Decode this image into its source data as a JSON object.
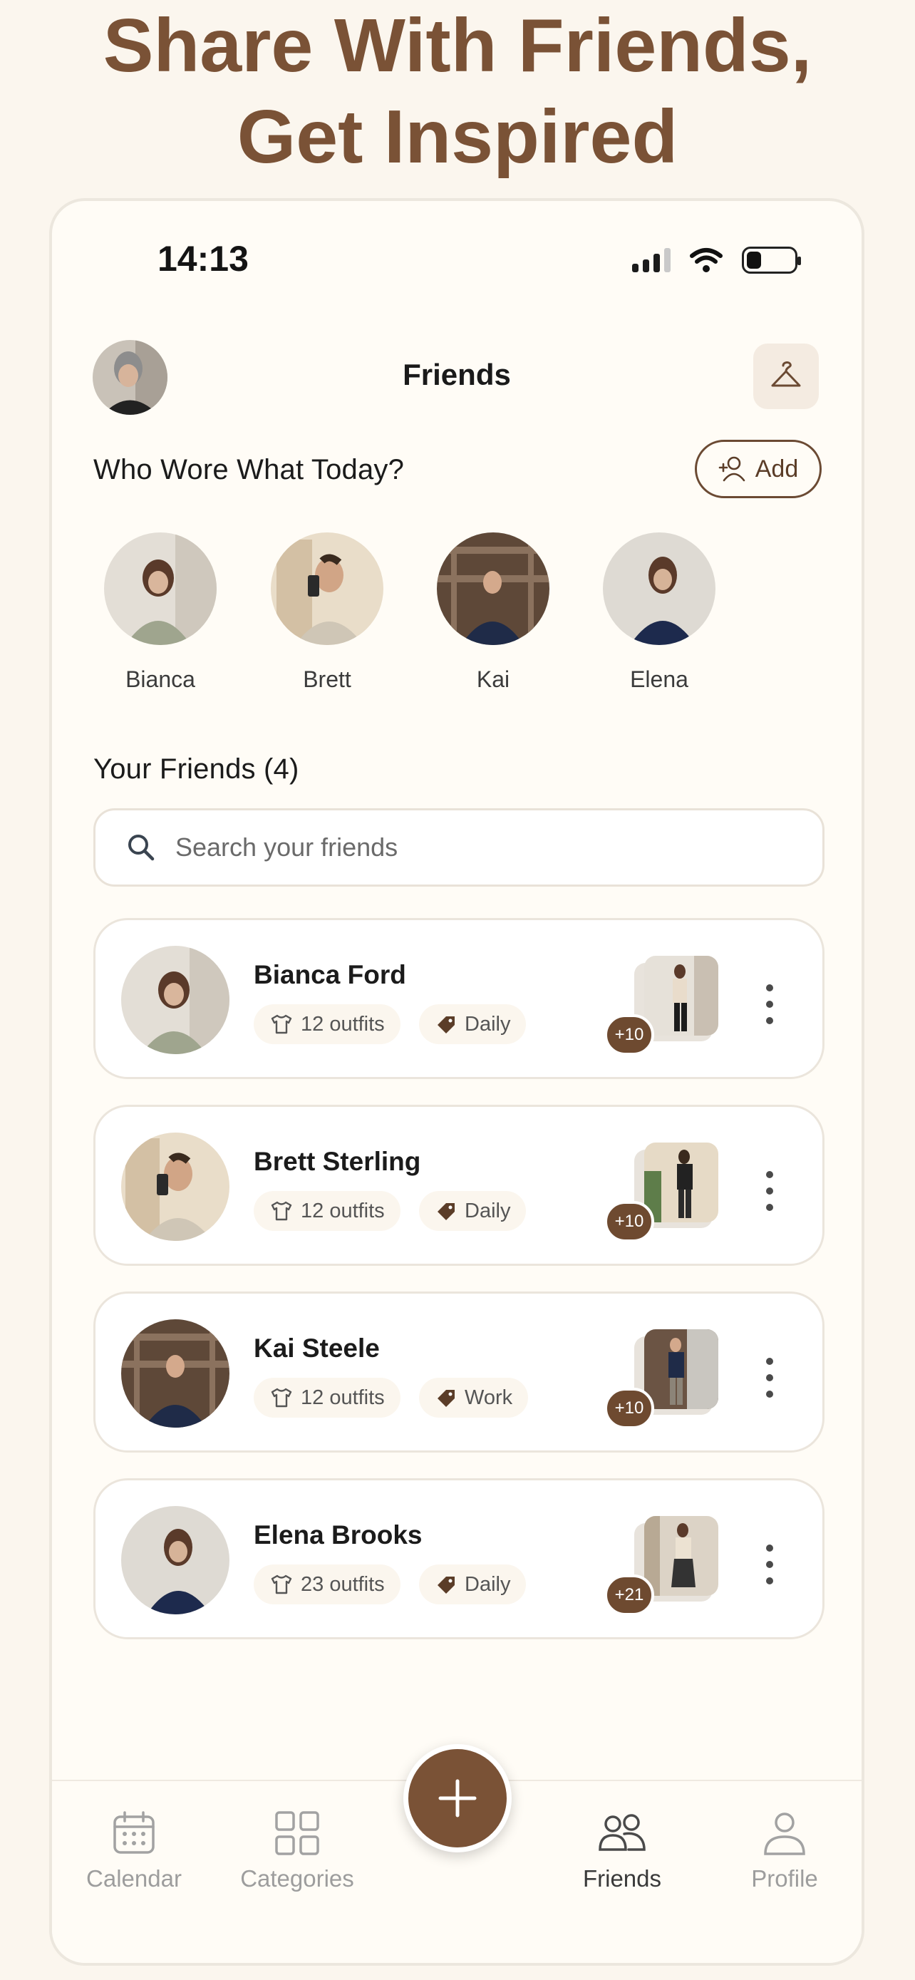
{
  "headline": {
    "line1": "Share With Friends,",
    "line2": "Get Inspired"
  },
  "status_bar": {
    "time": "14:13"
  },
  "header": {
    "title": "Friends"
  },
  "stories": {
    "title": "Who Wore What Today?",
    "add_label": "Add",
    "items": [
      {
        "name": "Bianca"
      },
      {
        "name": "Brett"
      },
      {
        "name": "Kai"
      },
      {
        "name": "Elena"
      }
    ]
  },
  "friends": {
    "title": "Your Friends (4)",
    "search_placeholder": "Search your friends",
    "items": [
      {
        "name": "Bianca Ford",
        "outfits": "12 outfits",
        "tag": "Daily",
        "more_count": "+10"
      },
      {
        "name": "Brett Sterling",
        "outfits": "12 outfits",
        "tag": "Daily",
        "more_count": "+10"
      },
      {
        "name": "Kai Steele",
        "outfits": "12 outfits",
        "tag": "Work",
        "more_count": "+10"
      },
      {
        "name": "Elena Brooks",
        "outfits": "23 outfits",
        "tag": "Daily",
        "more_count": "+21"
      }
    ]
  },
  "nav": {
    "items": [
      {
        "label": "Calendar",
        "icon": "calendar-icon"
      },
      {
        "label": "Categories",
        "icon": "grid-icon"
      },
      {
        "label": "Friends",
        "icon": "people-icon",
        "active": true
      },
      {
        "label": "Profile",
        "icon": "person-icon"
      }
    ],
    "fab_icon": "plus-icon"
  },
  "colors": {
    "accent": "#7a5236",
    "background": "#fbf6ee",
    "card": "#ffffff"
  }
}
